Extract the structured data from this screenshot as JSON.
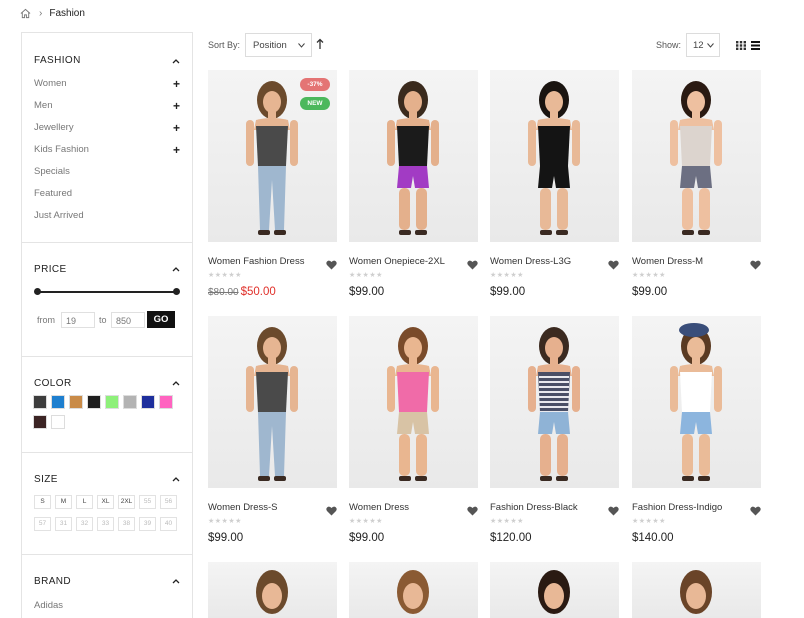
{
  "breadcrumb": {
    "home_icon": "home-icon",
    "current": "Fashion"
  },
  "sidebar": {
    "category": {
      "title": "FASHION",
      "items": [
        {
          "label": "Women",
          "expandable": true
        },
        {
          "label": "Men",
          "expandable": true
        },
        {
          "label": "Jewellery",
          "expandable": true
        },
        {
          "label": "Kids Fashion",
          "expandable": true
        },
        {
          "label": "Specials",
          "expandable": false
        },
        {
          "label": "Featured",
          "expandable": false
        },
        {
          "label": "Just Arrived",
          "expandable": false
        }
      ]
    },
    "price": {
      "title": "PRICE",
      "from_label": "from",
      "from_value": "19",
      "to_label": "to",
      "to_value": "850",
      "go_label": "GO"
    },
    "color": {
      "title": "COLOR",
      "swatches": [
        "#3d3d3d",
        "#1e7fcf",
        "#c98b48",
        "#1e1e1e",
        "#8ef07a",
        "#b3b3b3",
        "#1e2f9c",
        "#ff63c0",
        "#3b2424",
        "#ffffff"
      ]
    },
    "size": {
      "title": "SIZE",
      "row1": [
        "S",
        "M",
        "L",
        "XL",
        "2XL",
        "55",
        "56"
      ],
      "row2": [
        "57",
        "31",
        "32",
        "33",
        "38",
        "39",
        "40"
      ]
    },
    "brand": {
      "title": "BRAND",
      "items": [
        "Adidas"
      ]
    }
  },
  "toolbar": {
    "sort_label": "Sort By:",
    "sort_value": "Position",
    "show_label": "Show:",
    "show_value": "12"
  },
  "products": [
    {
      "name": "Women Fashion Dress",
      "old_price": "$80.00",
      "price": "$50.00",
      "badge_sale": "-37%",
      "badge_new": "NEW"
    },
    {
      "name": "Women Onepiece-2XL",
      "price": "$99.00"
    },
    {
      "name": "Women Dress-L3G",
      "price": "$99.00"
    },
    {
      "name": "Women Dress-M",
      "price": "$99.00"
    },
    {
      "name": "Women Dress-S",
      "price": "$99.00"
    },
    {
      "name": "Women Dress",
      "price": "$99.00"
    },
    {
      "name": "Fashion Dress-Black",
      "price": "$120.00"
    },
    {
      "name": "Fashion Dress-Indigo",
      "price": "$140.00"
    }
  ],
  "rating_stars": "★★★★★",
  "colors": {
    "sale_badge": "#e47474",
    "new_badge": "#4cb85c",
    "sale_price": "#e0302a"
  }
}
